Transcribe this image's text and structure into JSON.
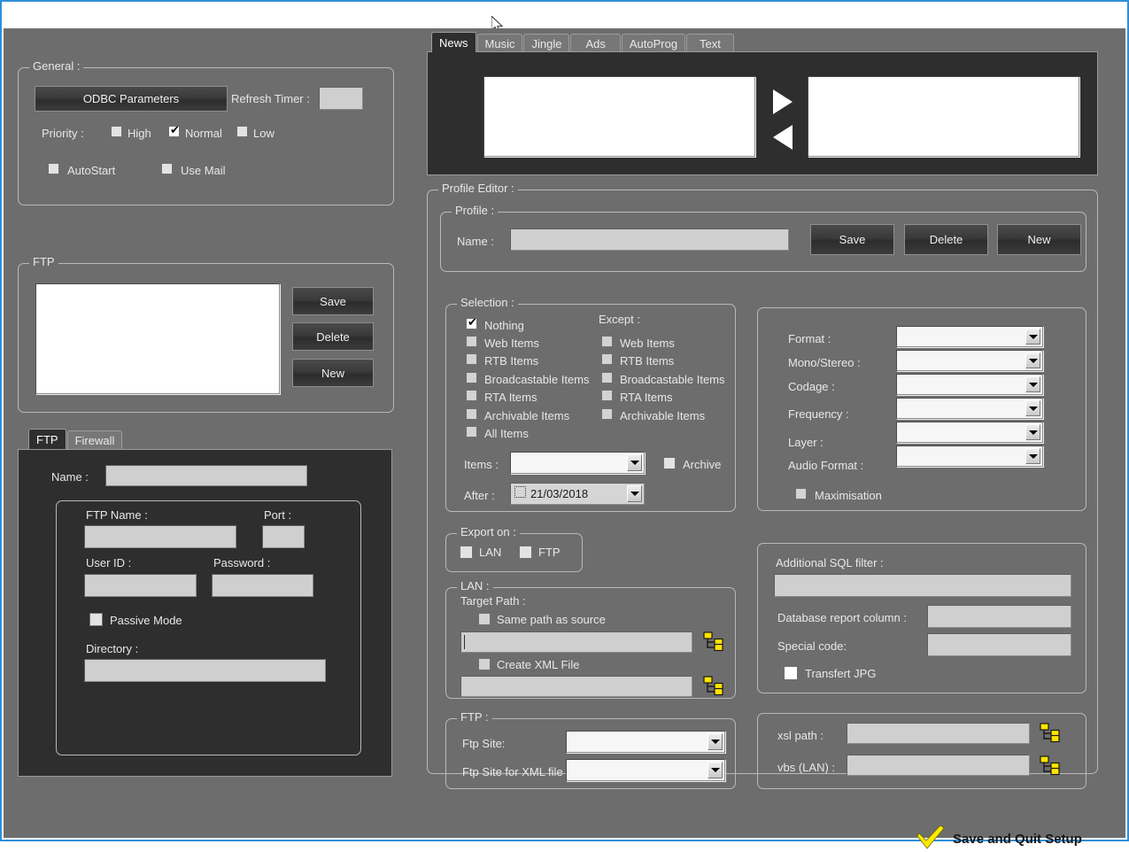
{
  "window": {
    "frame_color": "#2f8fd8",
    "surface_color": "#6d6d6d"
  },
  "general": {
    "title": "General :",
    "odbc_button": "ODBC Parameters",
    "refresh_timer_label": "Refresh Timer :",
    "refresh_timer_value": "",
    "priority_label": "Priority :",
    "priority": [
      {
        "label": "High",
        "checked": false
      },
      {
        "label": "Normal",
        "checked": true
      },
      {
        "label": "Low",
        "checked": false
      }
    ],
    "autostart": {
      "label": "AutoStart",
      "checked": false
    },
    "use_mail": {
      "label": "Use Mail",
      "checked": false
    }
  },
  "ftp_list": {
    "title": "FTP",
    "items": [],
    "save_label": "Save",
    "delete_label": "Delete",
    "new_label": "New"
  },
  "ftp_tabs": {
    "tabs": [
      {
        "label": "FTP",
        "active": true
      },
      {
        "label": "Firewall",
        "active": false
      }
    ],
    "name_label": "Name :",
    "name_value": "",
    "ftp_name_label": "FTP Name :",
    "ftp_name_value": "",
    "port_label": "Port :",
    "port_value": "",
    "user_id_label": "User ID :",
    "user_id_value": "",
    "password_label": "Password :",
    "password_value": "",
    "passive_mode": {
      "label": "Passive Mode",
      "checked": false
    },
    "directory_label": "Directory :",
    "directory_value": ""
  },
  "category_tabs": {
    "tabs": [
      {
        "label": "News",
        "active": true
      },
      {
        "label": "Music",
        "active": false
      },
      {
        "label": "Jingle",
        "active": false
      },
      {
        "label": "Ads",
        "active": false
      },
      {
        "label": "AutoProg",
        "active": false
      },
      {
        "label": "Text",
        "active": false
      }
    ],
    "left_list": [],
    "right_list": [],
    "move_right_icon": "triangle-right-icon",
    "move_left_icon": "triangle-left-icon"
  },
  "profile_editor": {
    "title": "Profile Editor :",
    "profile": {
      "title": "Profile :",
      "name_label": "Name :",
      "name_value": "",
      "save_label": "Save",
      "delete_label": "Delete",
      "new_label": "New"
    },
    "selection": {
      "title": "Selection :",
      "except_label": "Except :",
      "left": [
        {
          "label": "Nothing",
          "checked": true
        },
        {
          "label": "Web Items",
          "checked": false
        },
        {
          "label": "RTB Items",
          "checked": false
        },
        {
          "label": "Broadcastable Items",
          "checked": false
        },
        {
          "label": "RTA Items",
          "checked": false
        },
        {
          "label": "Archivable Items",
          "checked": false
        },
        {
          "label": "All Items",
          "checked": false
        }
      ],
      "except": [
        {
          "label": "Web Items",
          "checked": false
        },
        {
          "label": "RTB Items",
          "checked": false
        },
        {
          "label": "Broadcastable Items",
          "checked": false
        },
        {
          "label": "RTA Items",
          "checked": false
        },
        {
          "label": "Archivable Items",
          "checked": false
        }
      ],
      "items_label": "Items :",
      "items_value": "",
      "archive": {
        "label": "Archive",
        "checked": false
      },
      "after_label": "After :",
      "after_value": "21/03/2018"
    },
    "format": {
      "rows": [
        {
          "label": "Format :",
          "value": ""
        },
        {
          "label": "Mono/Stereo :",
          "value": ""
        },
        {
          "label": "Codage :",
          "value": ""
        },
        {
          "label": "Frequency :",
          "value": ""
        },
        {
          "label": "Layer :",
          "value": ""
        },
        {
          "label": "Audio Format :",
          "value": ""
        }
      ],
      "maximisation": {
        "label": "Maximisation",
        "checked": false
      }
    },
    "export_on": {
      "title": "Export on :",
      "lan": {
        "label": "LAN",
        "checked": false
      },
      "ftp": {
        "label": "FTP",
        "checked": false
      }
    },
    "lan": {
      "title": "LAN :",
      "target_path_label": "Target Path :",
      "same_path_as_source": {
        "label": "Same path as source",
        "checked": false
      },
      "target_path_value": "",
      "create_xml_file": {
        "label": "Create XML File",
        "checked": false
      },
      "xml_path_value": "",
      "browse_icon": "folder-tree-icon"
    },
    "ftp": {
      "title": "FTP :",
      "ftp_site_label": "Ftp Site:",
      "ftp_site_value": "",
      "ftp_site_xml_label": "Ftp Site for XML file :",
      "ftp_site_xml_value": ""
    },
    "sql": {
      "additional_sql_filter_label": "Additional SQL filter :",
      "additional_sql_filter_value": "",
      "database_report_column_label": "Database report column :",
      "database_report_column_value": "",
      "special_code_label": "Special code:",
      "special_code_value": "",
      "transfert_jpg": {
        "label": "Transfert JPG",
        "checked": false
      }
    },
    "paths": {
      "xsl_path_label": "xsl path :",
      "xsl_path_value": "",
      "vbs_lan_label": "vbs (LAN) :",
      "vbs_lan_value": "",
      "browse_icon": "folder-tree-icon"
    }
  },
  "footer": {
    "save_quit_label": "Save and Quit Setup",
    "check_icon": "yellow-check-icon",
    "check_color": "#FFE800"
  }
}
